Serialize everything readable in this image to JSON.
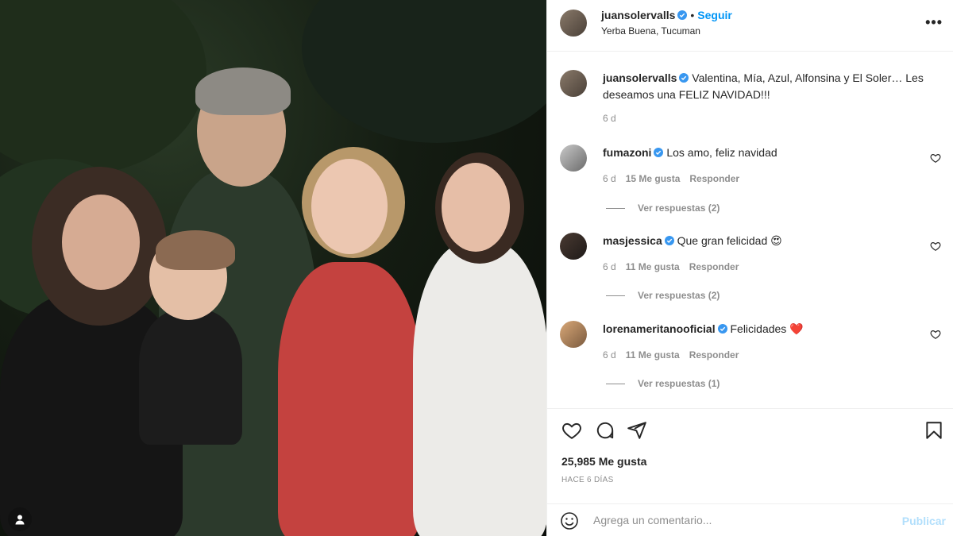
{
  "post": {
    "author": "juansolervalls",
    "follow_label": "Seguir",
    "location": "Yerba Buena, Tucuman",
    "caption_user": "juansolervalls",
    "caption": "Valentina, Mía, Azul, Alfonsina y El Soler… Les deseamos una FELIZ NAVIDAD!!!",
    "caption_age": "6 d"
  },
  "comments": [
    {
      "user": "fumazoni",
      "text": "Los amo, feliz navidad",
      "emoji": "",
      "age": "6 d",
      "likes": "15 Me gusta",
      "reply_label": "Responder",
      "replies": "Ver respuestas (2)"
    },
    {
      "user": "masjessica",
      "text": "Que gran felicidad",
      "emoji": "😍",
      "age": "6 d",
      "likes": "11 Me gusta",
      "reply_label": "Responder",
      "replies": "Ver respuestas (2)"
    },
    {
      "user": "lorenameritanooficial",
      "text": "Felicidades",
      "emoji": "❤️",
      "age": "6 d",
      "likes": "11 Me gusta",
      "reply_label": "Responder",
      "replies": "Ver respuestas (1)"
    }
  ],
  "actions": {
    "likes": "25,985 Me gusta",
    "ago": "HACE 6 DÍAS"
  },
  "composer": {
    "placeholder": "Agrega un comentario...",
    "publish_label": "Publicar"
  },
  "colors": {
    "accent": "#0095f6",
    "publish_disabled": "#b2dffc",
    "meta_text": "#8e8e8e"
  }
}
